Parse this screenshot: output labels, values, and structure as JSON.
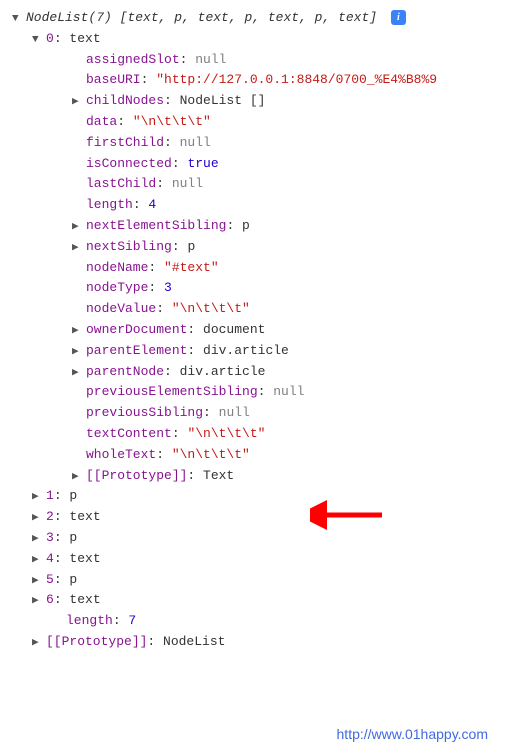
{
  "header": {
    "title": "NodeList(7)",
    "preview": "[text, p, text, p, text, p, text]"
  },
  "item0": {
    "index": "0",
    "type": "text",
    "props": {
      "assignedSlot": {
        "key": "assignedSlot",
        "val": "null",
        "type": "null"
      },
      "baseURI": {
        "key": "baseURI",
        "val": "\"http://127.0.0.1:8848/0700_%E4%B8%9",
        "type": "str"
      },
      "childNodes": {
        "key": "childNodes",
        "val": "NodeList []",
        "type": "obj",
        "expandable": true
      },
      "data": {
        "key": "data",
        "val": "\"\\n\\t\\t\\t\"",
        "type": "str"
      },
      "firstChild": {
        "key": "firstChild",
        "val": "null",
        "type": "null"
      },
      "isConnected": {
        "key": "isConnected",
        "val": "true",
        "type": "bool"
      },
      "lastChild": {
        "key": "lastChild",
        "val": "null",
        "type": "null"
      },
      "length": {
        "key": "length",
        "val": "4",
        "type": "num"
      },
      "nextElementSibling": {
        "key": "nextElementSibling",
        "val": "p",
        "type": "obj",
        "expandable": true
      },
      "nextSibling": {
        "key": "nextSibling",
        "val": "p",
        "type": "obj",
        "expandable": true
      },
      "nodeName": {
        "key": "nodeName",
        "val": "\"#text\"",
        "type": "str"
      },
      "nodeType": {
        "key": "nodeType",
        "val": "3",
        "type": "num"
      },
      "nodeValue": {
        "key": "nodeValue",
        "val": "\"\\n\\t\\t\\t\"",
        "type": "str"
      },
      "ownerDocument": {
        "key": "ownerDocument",
        "val": "document",
        "type": "obj",
        "expandable": true
      },
      "parentElement": {
        "key": "parentElement",
        "val": "div.article",
        "type": "obj",
        "expandable": true
      },
      "parentNode": {
        "key": "parentNode",
        "val": "div.article",
        "type": "obj",
        "expandable": true
      },
      "previousElementSibling": {
        "key": "previousElementSibling",
        "val": "null",
        "type": "null"
      },
      "previousSibling": {
        "key": "previousSibling",
        "val": "null",
        "type": "null"
      },
      "textContent": {
        "key": "textContent",
        "val": "\"\\n\\t\\t\\t\"",
        "type": "str"
      },
      "wholeText": {
        "key": "wholeText",
        "val": "\"\\n\\t\\t\\t\"",
        "type": "str"
      },
      "prototype": {
        "key": "[[Prototype]]",
        "val": "Text",
        "type": "obj",
        "expandable": true
      }
    }
  },
  "items": [
    {
      "index": "1",
      "type": "p"
    },
    {
      "index": "2",
      "type": "text"
    },
    {
      "index": "3",
      "type": "p"
    },
    {
      "index": "4",
      "type": "text"
    },
    {
      "index": "5",
      "type": "p"
    },
    {
      "index": "6",
      "type": "text"
    }
  ],
  "tail": {
    "length": {
      "key": "length",
      "val": "7"
    },
    "prototype": {
      "key": "[[Prototype]]",
      "val": "NodeList"
    }
  },
  "watermark": "http://www.01happy.com"
}
